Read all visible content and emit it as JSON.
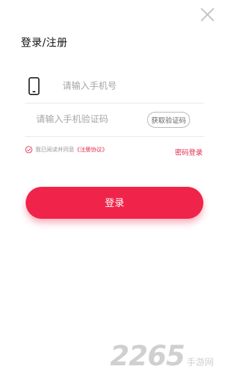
{
  "header": {
    "title": "登录/注册"
  },
  "form": {
    "phone_placeholder": "请输入手机号",
    "code_placeholder": "请输入手机验证码",
    "get_code_label": "获取验证码"
  },
  "agreement": {
    "prefix": "我已阅读并同意",
    "link_label": "《注册协议》"
  },
  "password_login_label": "密码登录",
  "login_button_label": "登录",
  "watermark": {
    "digits": "2265",
    "text": "手游网"
  },
  "colors": {
    "accent": "#f0244a",
    "link": "#e3294b"
  },
  "icons": [
    "close-icon",
    "phone-icon",
    "check-circle-icon"
  ]
}
